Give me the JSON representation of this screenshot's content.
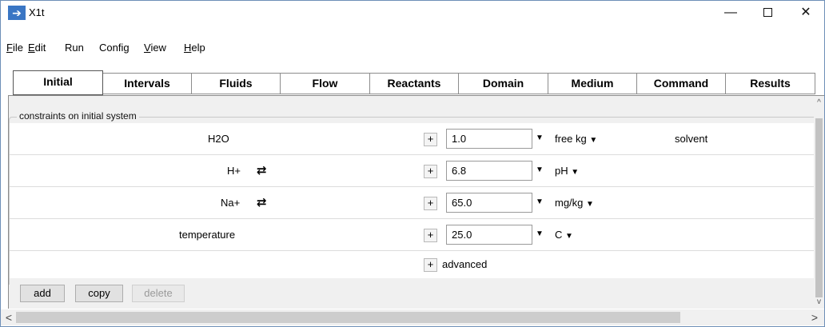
{
  "window": {
    "title": "X1t",
    "icon": "arrow-right-icon"
  },
  "menu": {
    "items": [
      {
        "label_u": "F",
        "label_rest": "ile"
      },
      {
        "label_u": "E",
        "label_rest": "dit"
      },
      {
        "label_u": "",
        "label_rest": "Run"
      },
      {
        "label_u": "",
        "label_rest": "Config"
      },
      {
        "label_u": "V",
        "label_rest": "iew"
      },
      {
        "label_u": "H",
        "label_rest": "elp"
      }
    ]
  },
  "tabs": [
    "Initial",
    "Intervals",
    "Fluids",
    "Flow",
    "Reactants",
    "Domain",
    "Medium",
    "Command",
    "Results"
  ],
  "active_tab": "Initial",
  "group": {
    "title": "constraints on initial system",
    "rows": [
      {
        "species": "H2O",
        "value": "1.0",
        "unit": "free kg",
        "note": "solvent",
        "swap": false
      },
      {
        "species": "H+",
        "value": "6.8",
        "unit": "pH",
        "note": "",
        "swap": true
      },
      {
        "species": "Na+",
        "value": "65.0",
        "unit": "mg/kg",
        "note": "",
        "swap": true
      },
      {
        "species": "temperature",
        "value": "25.0",
        "unit": "C",
        "note": "",
        "swap": false
      }
    ],
    "advanced_label": "advanced"
  },
  "buttons": {
    "add": "add",
    "copy": "copy",
    "delete": "delete"
  },
  "icons": {
    "plus": "+",
    "swap": "⇄",
    "dropdown": "▼",
    "minimize": "—",
    "close": "✕",
    "scroll_up": "^",
    "scroll_down": "v",
    "scroll_left": "<",
    "scroll_right": ">"
  }
}
